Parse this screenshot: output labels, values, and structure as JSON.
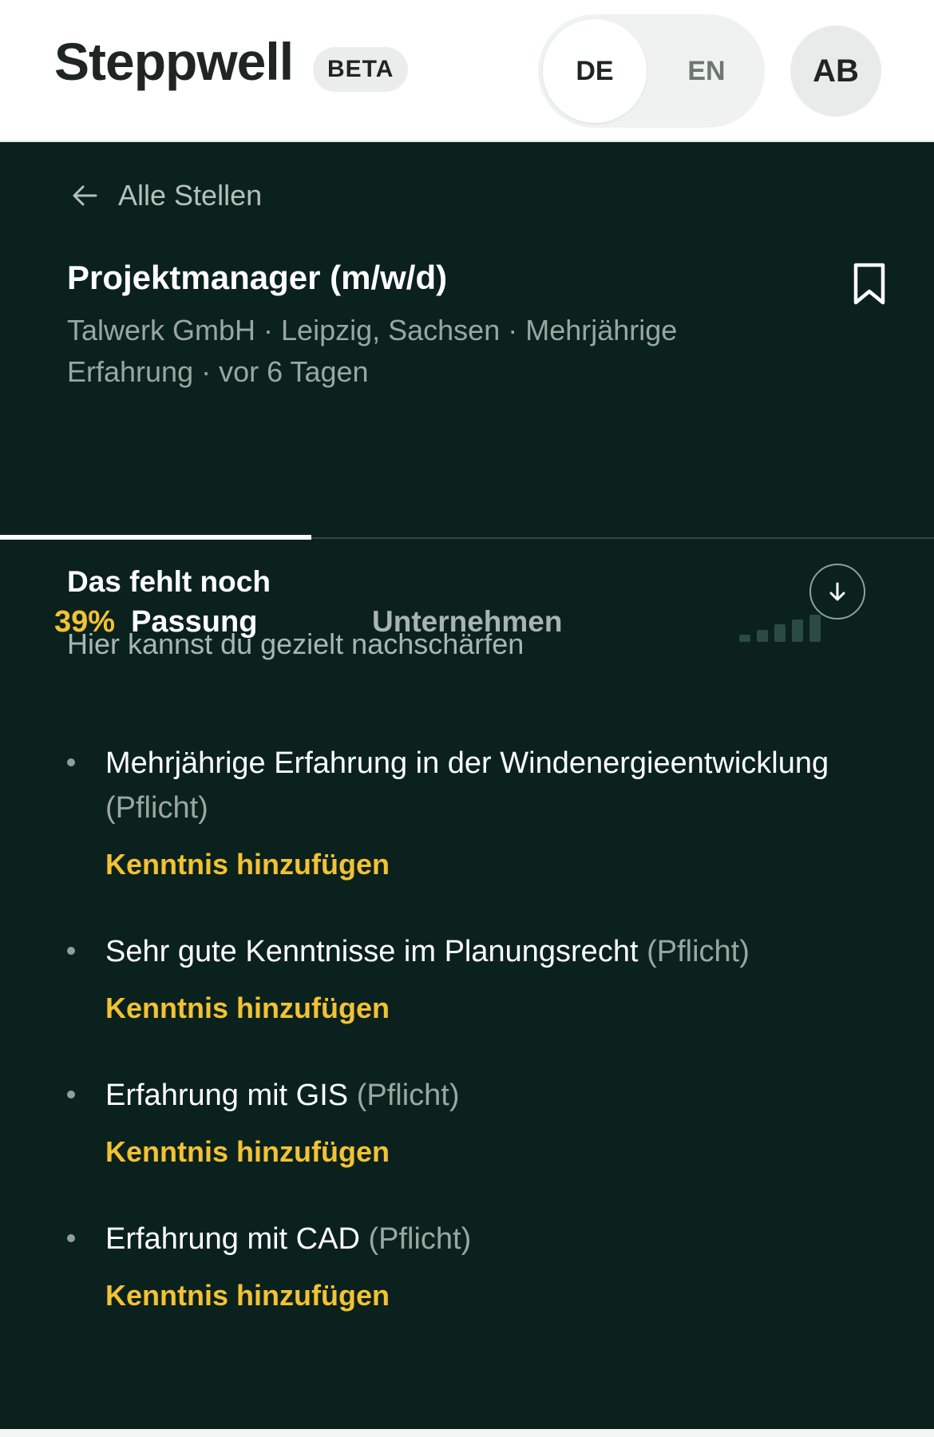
{
  "header": {
    "logo": "Steppwell",
    "beta_badge": "BETA",
    "lang_options": [
      {
        "label": "DE",
        "selected": true
      },
      {
        "label": "EN",
        "selected": false
      }
    ],
    "avatar_initials": "AB"
  },
  "nav": {
    "back_label": "Alle Stellen"
  },
  "job": {
    "title": "Projektmanager (m/w/d)",
    "meta": "Talwerk GmbH · Leipzig, Sachsen · Mehrjährige Erfahrung · vor 6 Tagen"
  },
  "tabs": {
    "fit_percent": "39%",
    "fit_label": "Passung",
    "company_label": "Unternehmen",
    "signal_level": 0.6
  },
  "section": {
    "title": "Das fehlt noch",
    "subtitle": "Hier kannst du gezielt nachschärfen"
  },
  "requirements": [
    {
      "text": "Mehrjährige Erfahrung in der Windenergieentwicklung",
      "tag": "(Pflicht)",
      "action": "Kenntnis hinzufügen"
    },
    {
      "text": "Sehr gute Kenntnisse im Planungsrecht",
      "tag": "(Pflicht)",
      "action": "Kenntnis hinzufügen"
    },
    {
      "text": "Erfahrung mit GIS",
      "tag": "(Pflicht)",
      "action": "Kenntnis hinzufügen"
    },
    {
      "text": "Erfahrung mit CAD",
      "tag": "(Pflicht)",
      "action": "Kenntnis hinzufügen"
    }
  ],
  "colors": {
    "accent": "#f2c233",
    "background": "#0b211d"
  }
}
